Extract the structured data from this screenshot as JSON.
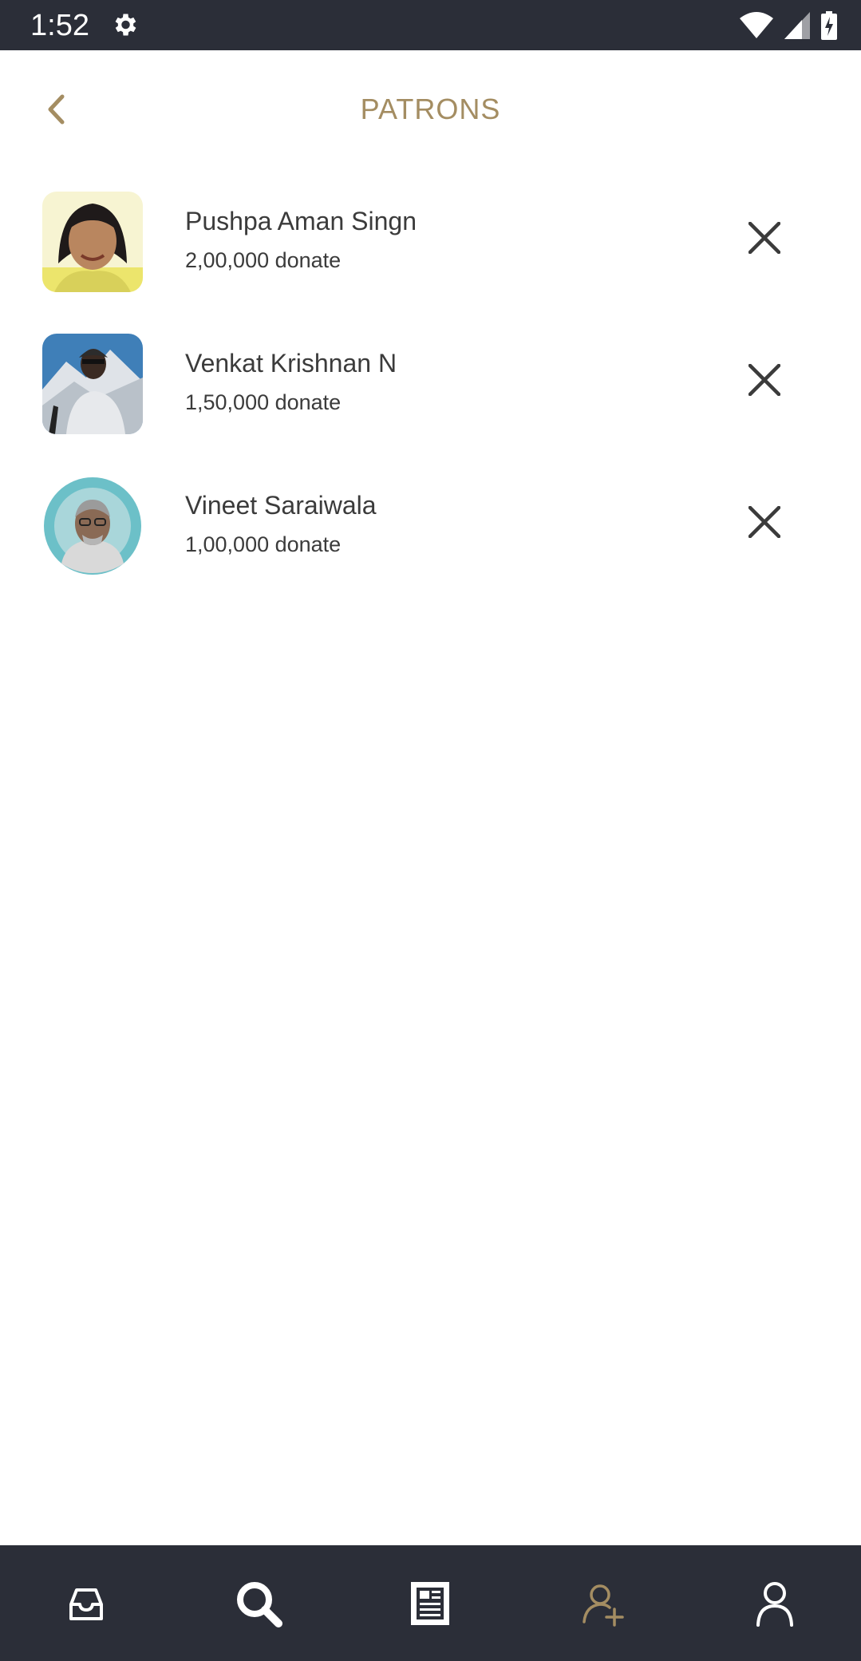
{
  "status_bar": {
    "time": "1:52",
    "icons": [
      "gear-icon",
      "wifi-icon",
      "cellular-signal-icon",
      "battery-charging-icon"
    ]
  },
  "header": {
    "title": "PATRONS",
    "back_icon": "chevron-left-icon"
  },
  "colors": {
    "accent": "#a48d62",
    "dark_bar": "#2b2e38",
    "text": "#3b3b3b",
    "background": "#ffffff"
  },
  "patrons": [
    {
      "name": "Pushpa Aman Singn",
      "amount": "2,00,000 donate",
      "remove_icon": "close-icon"
    },
    {
      "name": "Venkat Krishnan N",
      "amount": "1,50,000 donate",
      "remove_icon": "close-icon"
    },
    {
      "name": "Vineet Saraiwala",
      "amount": "1,00,000 donate",
      "remove_icon": "close-icon"
    }
  ],
  "bottom_nav": {
    "items": [
      {
        "icon": "inbox-icon",
        "active": false
      },
      {
        "icon": "search-icon",
        "active": false
      },
      {
        "icon": "document-icon",
        "active": false
      },
      {
        "icon": "add-patron-icon",
        "active": true
      },
      {
        "icon": "profile-icon",
        "active": false
      }
    ]
  }
}
